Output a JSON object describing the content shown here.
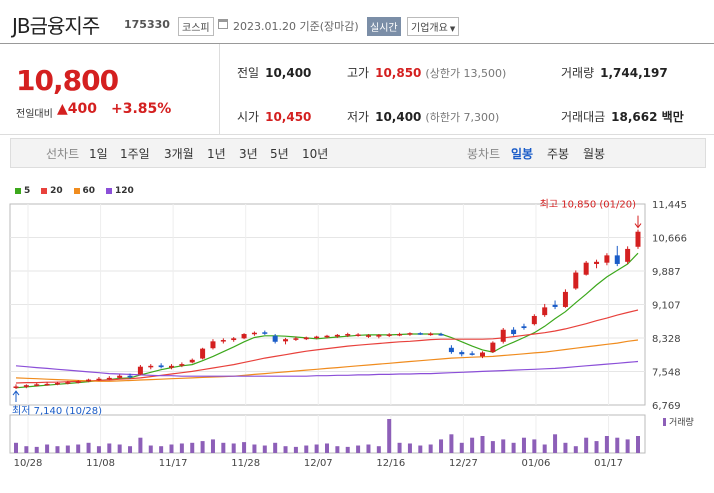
{
  "header": {
    "name": "JB금융지주",
    "code": "175330",
    "market": "코스피",
    "date": "2023.01.20",
    "basis": "기준(장마감)",
    "realtime_label": "실시간",
    "company_info_label": "기업개요"
  },
  "quote": {
    "price": "10,800",
    "prev_label": "전일대비",
    "change": "400",
    "change_pct": "+3.85%",
    "prev_close_label": "전일",
    "prev_close": "10,400",
    "open_label": "시가",
    "open": "10,450",
    "high_label": "고가",
    "high": "10,850",
    "upper_limit": "(상한가 13,500)",
    "low_label": "저가",
    "low": "10,400",
    "lower_limit": "(하한가 7,300)",
    "volume_label": "거래량",
    "volume": "1,744,197",
    "amount_label": "거래대금",
    "amount": "18,662 백만"
  },
  "tabs": {
    "line_label": "선차트",
    "line_periods": [
      "1일",
      "1주일",
      "3개월",
      "1년",
      "3년",
      "5년",
      "10년"
    ],
    "candle_label": "봉차트",
    "candle_periods": [
      "일봉",
      "주봉",
      "월봉"
    ]
  },
  "colors": {
    "up": "#d42020",
    "down": "#1a5cc8",
    "ma5": "#3ca81c",
    "ma20": "#e8413c",
    "ma60": "#f08c1e",
    "ma120": "#8b4fd8",
    "volume": "#8d5fb8"
  },
  "chart_data": {
    "type": "candlestick",
    "legend": [
      {
        "name": "5",
        "color": "#3ca81c"
      },
      {
        "name": "20",
        "color": "#e8413c"
      },
      {
        "name": "60",
        "color": "#f08c1e"
      },
      {
        "name": "120",
        "color": "#8b4fd8"
      }
    ],
    "y_ticks": [
      "11,445",
      "10,666",
      "9,887",
      "9,107",
      "8,328",
      "7,548",
      "6,769"
    ],
    "ylim": [
      6769,
      11445
    ],
    "x_ticks": [
      "10/28",
      "11/08",
      "11/17",
      "11/28",
      "12/07",
      "12/16",
      "12/27",
      "01/06",
      "01/17"
    ],
    "x_tick_index": [
      0,
      7,
      14,
      21,
      28,
      35,
      42,
      49,
      56
    ],
    "high_annotation": "최고 10,850 (01/20)",
    "low_annotation": "최저 7,140 (10/28)",
    "volume_label": "거래량",
    "candles": [
      {
        "o": 7170,
        "h": 7250,
        "l": 7140,
        "c": 7200
      },
      {
        "o": 7190,
        "h": 7250,
        "l": 7160,
        "c": 7230
      },
      {
        "o": 7230,
        "h": 7280,
        "l": 7200,
        "c": 7250
      },
      {
        "o": 7250,
        "h": 7300,
        "l": 7220,
        "c": 7260
      },
      {
        "o": 7260,
        "h": 7310,
        "l": 7230,
        "c": 7280
      },
      {
        "o": 7280,
        "h": 7330,
        "l": 7250,
        "c": 7300
      },
      {
        "o": 7300,
        "h": 7350,
        "l": 7270,
        "c": 7320
      },
      {
        "o": 7320,
        "h": 7380,
        "l": 7300,
        "c": 7360
      },
      {
        "o": 7360,
        "h": 7420,
        "l": 7330,
        "c": 7380
      },
      {
        "o": 7380,
        "h": 7440,
        "l": 7340,
        "c": 7400
      },
      {
        "o": 7400,
        "h": 7480,
        "l": 7380,
        "c": 7450
      },
      {
        "o": 7450,
        "h": 7500,
        "l": 7380,
        "c": 7420
      },
      {
        "o": 7480,
        "h": 7700,
        "l": 7460,
        "c": 7660
      },
      {
        "o": 7660,
        "h": 7720,
        "l": 7600,
        "c": 7680
      },
      {
        "o": 7690,
        "h": 7740,
        "l": 7620,
        "c": 7650
      },
      {
        "o": 7640,
        "h": 7720,
        "l": 7600,
        "c": 7680
      },
      {
        "o": 7690,
        "h": 7760,
        "l": 7650,
        "c": 7720
      },
      {
        "o": 7760,
        "h": 7850,
        "l": 7740,
        "c": 7820
      },
      {
        "o": 7850,
        "h": 8100,
        "l": 7830,
        "c": 8080
      },
      {
        "o": 8090,
        "h": 8300,
        "l": 8060,
        "c": 8250
      },
      {
        "o": 8260,
        "h": 8320,
        "l": 8200,
        "c": 8280
      },
      {
        "o": 8280,
        "h": 8350,
        "l": 8240,
        "c": 8320
      },
      {
        "o": 8320,
        "h": 8440,
        "l": 8300,
        "c": 8420
      },
      {
        "o": 8420,
        "h": 8480,
        "l": 8380,
        "c": 8450
      },
      {
        "o": 8460,
        "h": 8500,
        "l": 8400,
        "c": 8440
      },
      {
        "o": 8380,
        "h": 8420,
        "l": 8200,
        "c": 8240
      },
      {
        "o": 8250,
        "h": 8330,
        "l": 8180,
        "c": 8300
      },
      {
        "o": 8300,
        "h": 8360,
        "l": 8260,
        "c": 8320
      },
      {
        "o": 8300,
        "h": 8360,
        "l": 8280,
        "c": 8340
      },
      {
        "o": 8330,
        "h": 8380,
        "l": 8300,
        "c": 8360
      },
      {
        "o": 8350,
        "h": 8400,
        "l": 8320,
        "c": 8380
      },
      {
        "o": 8370,
        "h": 8420,
        "l": 8330,
        "c": 8400
      },
      {
        "o": 8390,
        "h": 8450,
        "l": 8350,
        "c": 8420
      },
      {
        "o": 8400,
        "h": 8440,
        "l": 8360,
        "c": 8410
      },
      {
        "o": 8370,
        "h": 8420,
        "l": 8330,
        "c": 8390
      },
      {
        "o": 8360,
        "h": 8420,
        "l": 8320,
        "c": 8400
      },
      {
        "o": 8390,
        "h": 8440,
        "l": 8350,
        "c": 8410
      },
      {
        "o": 8400,
        "h": 8450,
        "l": 8370,
        "c": 8420
      },
      {
        "o": 8410,
        "h": 8460,
        "l": 8380,
        "c": 8440
      },
      {
        "o": 8440,
        "h": 8460,
        "l": 8400,
        "c": 8420
      },
      {
        "o": 8420,
        "h": 8460,
        "l": 8380,
        "c": 8430
      },
      {
        "o": 8420,
        "h": 8450,
        "l": 8380,
        "c": 8410
      },
      {
        "o": 8100,
        "h": 8160,
        "l": 7960,
        "c": 8000
      },
      {
        "o": 8000,
        "h": 8040,
        "l": 7900,
        "c": 7950
      },
      {
        "o": 7970,
        "h": 8020,
        "l": 7920,
        "c": 7940
      },
      {
        "o": 7900,
        "h": 8020,
        "l": 7860,
        "c": 7990
      },
      {
        "o": 8000,
        "h": 8250,
        "l": 7980,
        "c": 8220
      },
      {
        "o": 8240,
        "h": 8560,
        "l": 8200,
        "c": 8520
      },
      {
        "o": 8520,
        "h": 8580,
        "l": 8380,
        "c": 8420
      },
      {
        "o": 8600,
        "h": 8660,
        "l": 8520,
        "c": 8560
      },
      {
        "o": 8650,
        "h": 8880,
        "l": 8620,
        "c": 8840
      },
      {
        "o": 8860,
        "h": 9120,
        "l": 8820,
        "c": 9040
      },
      {
        "o": 9100,
        "h": 9200,
        "l": 9000,
        "c": 9050
      },
      {
        "o": 9050,
        "h": 9460,
        "l": 9030,
        "c": 9400
      },
      {
        "o": 9480,
        "h": 9900,
        "l": 9450,
        "c": 9850
      },
      {
        "o": 9800,
        "h": 10120,
        "l": 9780,
        "c": 10080
      },
      {
        "o": 10050,
        "h": 10150,
        "l": 9950,
        "c": 10100
      },
      {
        "o": 10080,
        "h": 10300,
        "l": 10020,
        "c": 10250
      },
      {
        "o": 10250,
        "h": 10470,
        "l": 10000,
        "c": 10050
      },
      {
        "o": 10100,
        "h": 10460,
        "l": 10050,
        "c": 10400
      },
      {
        "o": 10450,
        "h": 10850,
        "l": 10400,
        "c": 10800
      }
    ],
    "volumes": [
      30,
      20,
      18,
      25,
      20,
      22,
      25,
      30,
      20,
      28,
      25,
      20,
      45,
      22,
      20,
      25,
      28,
      30,
      35,
      40,
      30,
      28,
      32,
      25,
      22,
      30,
      20,
      18,
      22,
      25,
      28,
      20,
      18,
      22,
      25,
      20,
      100,
      30,
      28,
      22,
      25,
      40,
      55,
      30,
      45,
      50,
      35,
      40,
      30,
      45,
      40,
      25,
      55,
      30,
      20,
      45,
      35,
      50,
      45,
      40,
      50
    ],
    "ma": {
      "5": {
        "start": 0,
        "values": [
          7170,
          7190,
          7210,
          7230,
          7250,
          7270,
          7290,
          7310,
          7340,
          7360,
          7390,
          7400,
          7470,
          7530,
          7590,
          7640,
          7680,
          7710,
          7800,
          7900,
          8010,
          8120,
          8240,
          8340,
          8380,
          8380,
          8370,
          8350,
          8330,
          8310,
          8330,
          8350,
          8370,
          8390,
          8400,
          8400,
          8400,
          8410,
          8420,
          8420,
          8420,
          8420,
          8340,
          8240,
          8140,
          8050,
          8000,
          8130,
          8230,
          8340,
          8450,
          8600,
          8780,
          8940,
          9150,
          9350,
          9560,
          9750,
          9900,
          10050,
          10300
        ]
      },
      "20": {
        "start": 0,
        "values": [
          7280,
          7290,
          7290,
          7300,
          7300,
          7310,
          7320,
          7330,
          7340,
          7350,
          7370,
          7380,
          7400,
          7430,
          7460,
          7490,
          7520,
          7550,
          7590,
          7630,
          7670,
          7710,
          7760,
          7810,
          7860,
          7900,
          7940,
          7980,
          8020,
          8050,
          8080,
          8110,
          8140,
          8160,
          8180,
          8200,
          8220,
          8240,
          8250,
          8270,
          8290,
          8300,
          8300,
          8300,
          8300,
          8300,
          8310,
          8330,
          8360,
          8390,
          8420,
          8450,
          8490,
          8540,
          8600,
          8660,
          8730,
          8790,
          8860,
          8920,
          8980
        ]
      },
      "60": {
        "start": 0,
        "values": [
          7400,
          7390,
          7380,
          7370,
          7360,
          7350,
          7340,
          7330,
          7320,
          7320,
          7330,
          7340,
          7350,
          7360,
          7370,
          7380,
          7390,
          7400,
          7410,
          7420,
          7430,
          7440,
          7460,
          7480,
          7500,
          7520,
          7540,
          7560,
          7580,
          7600,
          7620,
          7640,
          7660,
          7680,
          7700,
          7720,
          7740,
          7760,
          7780,
          7800,
          7820,
          7840,
          7860,
          7870,
          7880,
          7890,
          7900,
          7920,
          7940,
          7960,
          7980,
          8000,
          8030,
          8060,
          8090,
          8120,
          8150,
          8180,
          8210,
          8250,
          8280
        ]
      },
      "120": {
        "start": 0,
        "values": [
          7680,
          7660,
          7640,
          7620,
          7600,
          7580,
          7560,
          7540,
          7520,
          7500,
          7490,
          7480,
          7470,
          7460,
          7450,
          7450,
          7440,
          7440,
          7440,
          7440,
          7440,
          7440,
          7440,
          7440,
          7440,
          7440,
          7440,
          7440,
          7440,
          7450,
          7450,
          7460,
          7460,
          7470,
          7470,
          7480,
          7480,
          7490,
          7490,
          7500,
          7500,
          7510,
          7520,
          7530,
          7540,
          7550,
          7560,
          7570,
          7580,
          7590,
          7600,
          7610,
          7620,
          7640,
          7660,
          7680,
          7700,
          7720,
          7740,
          7760,
          7780
        ]
      }
    }
  }
}
